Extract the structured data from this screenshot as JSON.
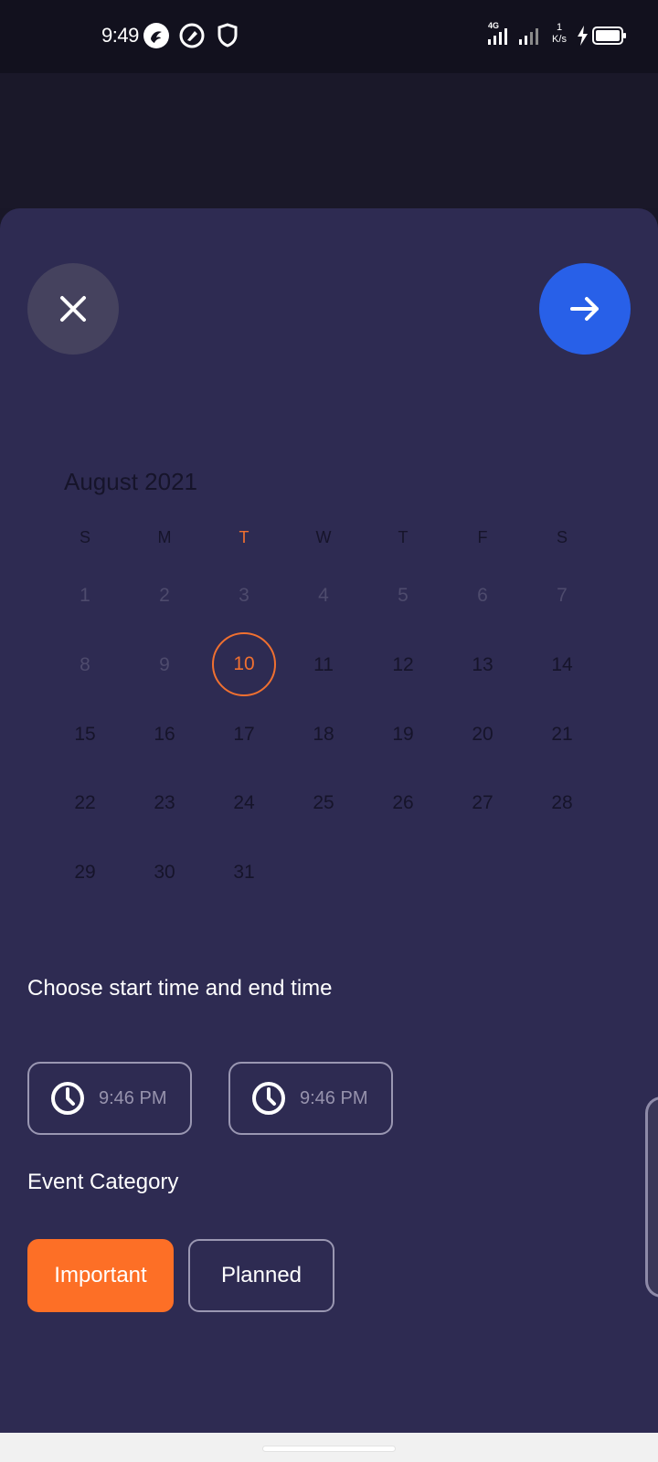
{
  "status": {
    "time": "9:49",
    "network": "4G",
    "speed": "1",
    "speed_unit": "K/s"
  },
  "calendar": {
    "month": "August 2021",
    "weekdays": [
      "S",
      "M",
      "T",
      "W",
      "T",
      "F",
      "S"
    ],
    "today_weekday_index": 2,
    "weeks": [
      [
        "1",
        "2",
        "3",
        "4",
        "5",
        "6",
        "7"
      ],
      [
        "8",
        "9",
        "10",
        "11",
        "12",
        "13",
        "14"
      ],
      [
        "15",
        "16",
        "17",
        "18",
        "19",
        "20",
        "21"
      ],
      [
        "22",
        "23",
        "24",
        "25",
        "26",
        "27",
        "28"
      ],
      [
        "29",
        "30",
        "31"
      ]
    ],
    "selected_day": "10",
    "disabled_before_day": 10
  },
  "time_section": {
    "title": "Choose start time and end time",
    "start_time": "9:46 PM",
    "end_time": "9:46 PM"
  },
  "category_section": {
    "title": "Event Category",
    "options": [
      "Important",
      "Planned"
    ],
    "selected": "Important"
  },
  "colors": {
    "sheet": "#2e2b52",
    "accent_orange": "#fd6f26",
    "accent_blue": "#2860e8",
    "close_bg": "#45425e"
  },
  "icons": {
    "close": "close-icon",
    "next": "arrow-right-icon",
    "clock": "clock-icon"
  }
}
